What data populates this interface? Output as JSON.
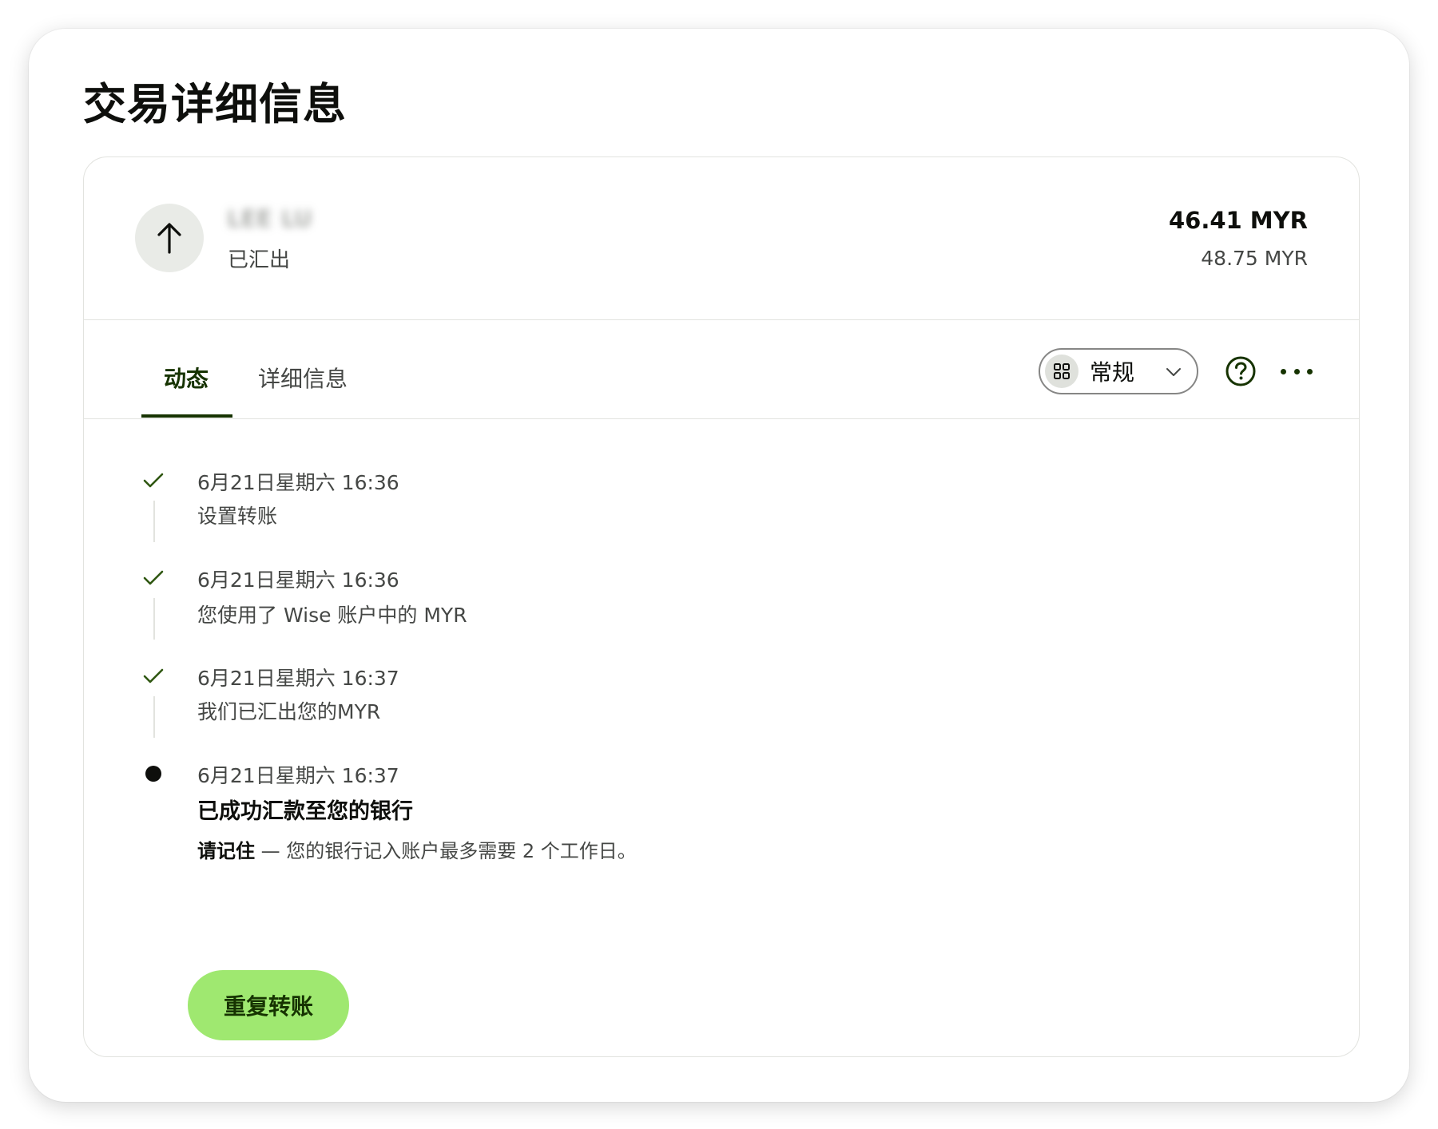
{
  "page": {
    "title": "交易详细信息"
  },
  "summary": {
    "recipient_name": "LEE LU",
    "status": "已汇出",
    "amount_primary": "46.41 MYR",
    "amount_secondary": "48.75 MYR"
  },
  "tabs": [
    {
      "label": "动态",
      "active": true
    },
    {
      "label": "详细信息",
      "active": false
    }
  ],
  "view_select": {
    "value": "常规"
  },
  "timeline": [
    {
      "date": "6月21日星期六 16:36",
      "text": "设置转账",
      "state": "done"
    },
    {
      "date": "6月21日星期六 16:36",
      "text": "您使用了 Wise 账户中的 MYR",
      "state": "done"
    },
    {
      "date": "6月21日星期六 16:37",
      "text": "我们已汇出您的MYR",
      "state": "done"
    },
    {
      "date": "6月21日星期六 16:37",
      "text": "已成功汇款至您的银行",
      "state": "current",
      "note_bold": "请记住",
      "note": " — 您的银行记入账户最多需要 2 个工作日。"
    }
  ],
  "actions": {
    "repeat_label": "重复转账"
  },
  "colors": {
    "accent": "#163300",
    "button_green": "#9fe870",
    "border": "#e2e3df",
    "avatar_bg": "#e9ebe7"
  }
}
